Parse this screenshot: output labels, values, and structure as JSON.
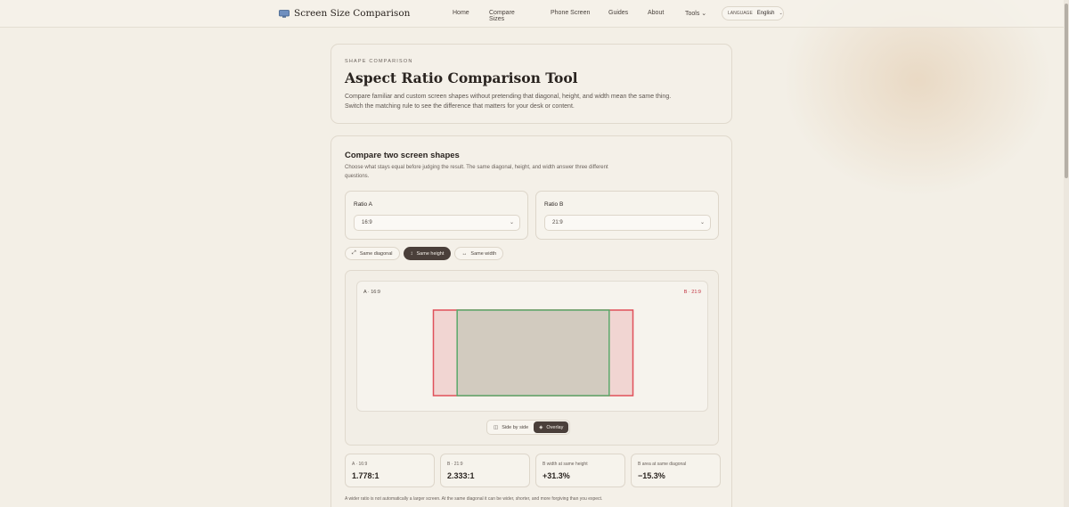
{
  "header": {
    "brand": "Screen Size Comparison",
    "nav": [
      "Home",
      "Compare Sizes",
      "Phone Screen",
      "Guides",
      "About",
      "Tools"
    ],
    "lang_label": "LANGUAGE",
    "lang_value": "English"
  },
  "hero": {
    "eyebrow": "SHAPE COMPARISON",
    "title": "Aspect Ratio Comparison Tool",
    "text": "Compare familiar and custom screen shapes without pretending that diagonal, height, and width mean the same thing. Switch the matching rule to see the difference that matters for your desk or content."
  },
  "tool": {
    "title": "Compare two screen shapes",
    "desc": "Choose what stays equal before judging the result. The same diagonal, height, and width answer three different questions.",
    "ratio_a": {
      "label": "Ratio A",
      "value": "16:9"
    },
    "ratio_b": {
      "label": "Ratio B",
      "value": "21:9"
    },
    "modes": [
      "Same diagonal",
      "Same height",
      "Same width"
    ],
    "active_mode": "Same height",
    "viz": {
      "tag_a": "A · 16:9",
      "tag_b": "B · 21:9"
    },
    "view": [
      "Side by side",
      "Overlay"
    ],
    "active_view": "Overlay",
    "stats": [
      {
        "label": "A · 16:9",
        "value": "1.778:1"
      },
      {
        "label": "B · 21:9",
        "value": "2.333:1"
      },
      {
        "label": "B width at same height",
        "value": "+31.3%"
      },
      {
        "label": "B area at same diagonal",
        "value": "−15.3%"
      }
    ],
    "note": "A wider ratio is not automatically a larger screen. At the same diagonal it can be wider, shorter, and more forgiving than you expect."
  },
  "colors": {
    "accent_dark": "#4a3f3a",
    "ratio_a": "#5aa86a",
    "ratio_b": "#e0505a",
    "background": "#f3efe6"
  },
  "chart_data": {
    "type": "overlay",
    "ratio_a": [
      16,
      9
    ],
    "ratio_b": [
      21,
      9
    ],
    "match": "height"
  }
}
